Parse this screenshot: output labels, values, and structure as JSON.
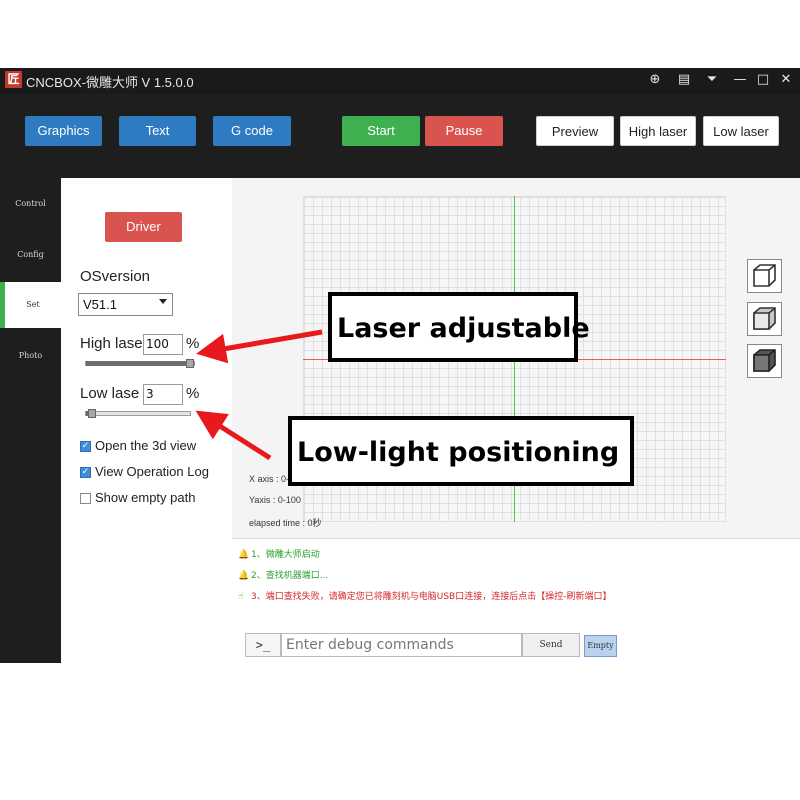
{
  "window": {
    "title": "CNCBOX-微雕大师 V 1.5.0.0",
    "logo_text": "匠",
    "titlebar_icons": [
      "globe-icon",
      "chat-icon",
      "download-icon",
      "minimize-icon",
      "maximize-icon",
      "close-icon"
    ]
  },
  "titlebar_glyphs": {
    "globe": "⊕",
    "chat": "▤",
    "download": "⏷",
    "minimize": "—",
    "maximize": "□",
    "close": "✕"
  },
  "toolbar": {
    "graphics": "Graphics",
    "text": "Text",
    "gcode": "G code",
    "start": "Start",
    "pause": "Pause",
    "preview": "Preview",
    "high_laser": "High laser",
    "low_laser": "Low laser"
  },
  "side_tabs": [
    "Control",
    "Config",
    "Set",
    "Photo"
  ],
  "active_tab": "Set",
  "settings": {
    "driver_button": "Driver",
    "os_version_label": "OSversion",
    "os_version_value": "V51.1",
    "high_laser_label": "High lase",
    "high_laser_value": "100",
    "low_laser_label": "Low lase",
    "low_laser_value": "3",
    "percent": "%",
    "high_laser_level": 1.0,
    "low_laser_level": 0.03,
    "checkboxes": [
      {
        "label": "Open the 3d view",
        "checked": true
      },
      {
        "label": "View Operation Log",
        "checked": true
      },
      {
        "label": "Show empty path",
        "checked": false
      }
    ]
  },
  "canvas": {
    "x_axis": "X axis : 0-100",
    "y_axis": "Yaxis : 0-100",
    "elapsed": "elapsed time : 0秒",
    "view_buttons": [
      "view-3d-wireframe-icon",
      "view-3d-shaded-icon",
      "view-3d-solid-icon"
    ]
  },
  "log": {
    "lines": [
      {
        "text": "1、微雕大师启动",
        "color": "#2ca02c"
      },
      {
        "text": "2、查找机器端口...",
        "color": "#2ca02c"
      },
      {
        "text": "3、端口查找失败，请确定您已将雕刻机与电脑USB口连接，连接后点击【操控-刷新端口】",
        "color": "#d62728"
      }
    ],
    "prompt": ">_",
    "input_placeholder": "Enter debug commands",
    "send": "Send",
    "empty": "Empty"
  },
  "annotations": {
    "laser_adjustable": "Laser adjustable",
    "low_light_positioning": "Low-light positioning"
  },
  "colors": {
    "accent_blue": "#2f7bc2",
    "start_green": "#3fb050",
    "pause_red": "#d9534f",
    "driver_red": "#d9534f",
    "annotation_arrow": "#e8191c"
  }
}
